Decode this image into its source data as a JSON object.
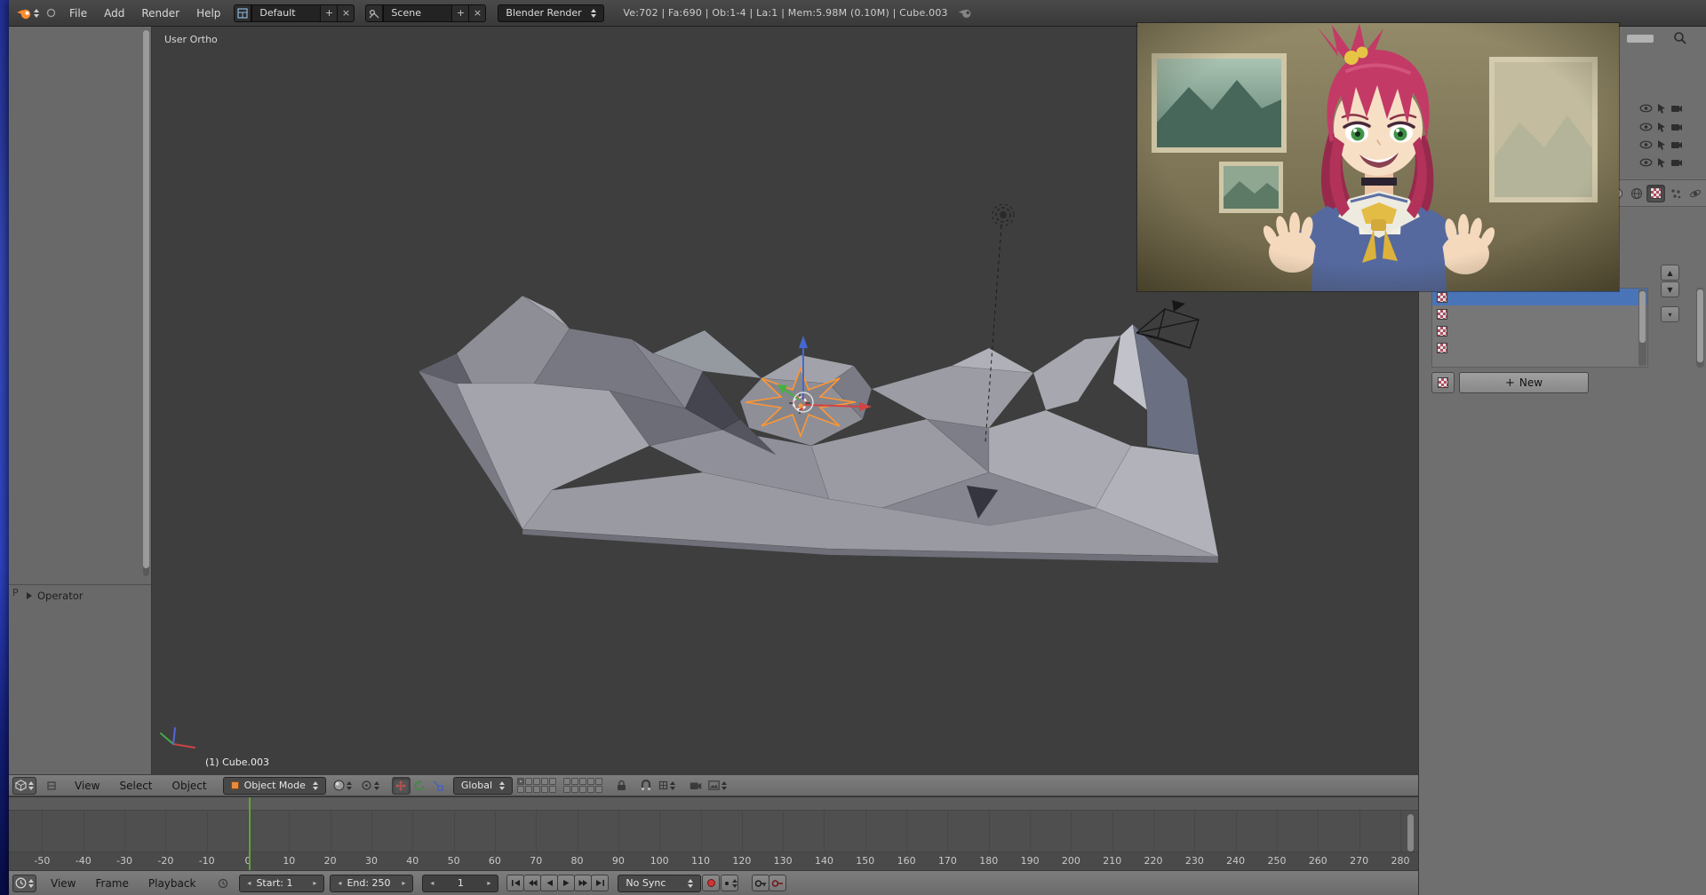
{
  "colors": {
    "info_bar_bg": "#3d3d3d",
    "region_bg": "#6f6f6f",
    "viewport_bg": "#3e3e3e",
    "timeline_bg": "#4f4f4f",
    "selection_blue": "#4a74b8",
    "selection_orange": "#ff9633",
    "current_frame_green": "#61a43b",
    "wallpaper_blue": "#1b2a9c"
  },
  "info_bar": {
    "menus": [
      "File",
      "Add",
      "Render",
      "Help"
    ],
    "screen_layout_value": "Default",
    "scene_value": "Scene",
    "engine_value": "Blender Render",
    "stats": "Ve:702 | Fa:690 | Ob:1-4 | La:1 | Mem:5.98M (0.10M) | Cube.003"
  },
  "tool_shelf": {
    "operator_panel_label": "Operator",
    "panel_tab_label": "P"
  },
  "viewport": {
    "view_label": "User Ortho",
    "active_object_label": "(1) Cube.003"
  },
  "viewport_header": {
    "menus": [
      "View",
      "Select",
      "Object"
    ],
    "mode_value": "Object Mode",
    "orientation_value": "Global"
  },
  "timeline": {
    "menus": [
      "View",
      "Frame",
      "Playback"
    ],
    "start_value": "Start: 1",
    "end_value": "End: 250",
    "frame_value": "1",
    "sync_value": "No Sync",
    "ruler_frames": [
      -50,
      -40,
      -30,
      -20,
      -10,
      0,
      10,
      20,
      30,
      40,
      50,
      60,
      70,
      80,
      90,
      100,
      110,
      120,
      130,
      140,
      150,
      160,
      170,
      180,
      190,
      200,
      210,
      220,
      230,
      240,
      250,
      260,
      270,
      280
    ]
  },
  "properties": {
    "new_button_label": "New"
  }
}
